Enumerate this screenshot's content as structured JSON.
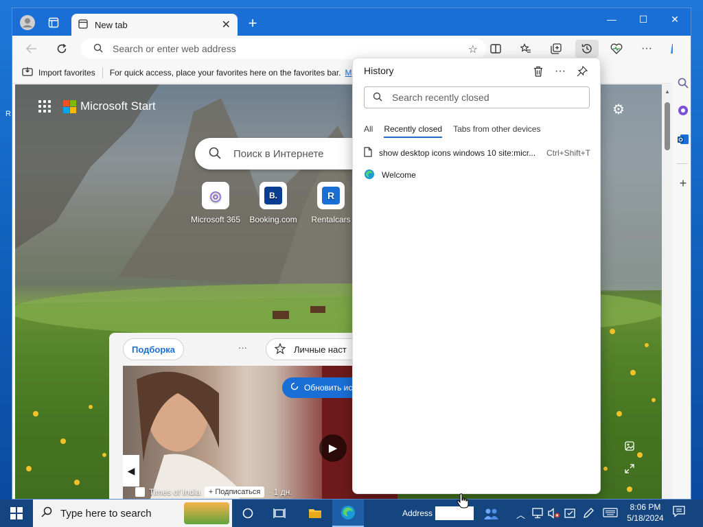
{
  "desktop": {
    "edge_letter": "R"
  },
  "browser": {
    "tab": {
      "title": "New tab",
      "close": "✕"
    },
    "new_tab": "+",
    "window_controls": {
      "minimize": "—",
      "maximize": "☐",
      "close": "✕"
    },
    "address": {
      "placeholder": "Search or enter web address"
    },
    "favorites_bar": {
      "import_label": "Import favorites",
      "hint": "For quick access, place your favorites here on the favorites bar.",
      "link": "M"
    }
  },
  "page": {
    "brand": "Microsoft Start",
    "search_placeholder": "Поиск в Интернете",
    "quick_links": [
      {
        "label": "Microsoft 365",
        "glyph": "◎",
        "color": "#7b4fd6"
      },
      {
        "label": "Booking.com",
        "glyph": "B.",
        "color": "#0b3d91"
      },
      {
        "label": "Rentalcars",
        "glyph": "R",
        "color": "#1a6fd6"
      }
    ],
    "feed": {
      "tab_selected": "Подборка",
      "more": "···",
      "personalize": "Личные наст",
      "refresh": "Обновить ист",
      "source": "Times of India",
      "subscribe": "+ Подписаться",
      "age": "· 1 дн."
    }
  },
  "history": {
    "title": "History",
    "search_placeholder": "Search recently closed",
    "tabs": [
      "All",
      "Recently closed",
      "Tabs from other devices"
    ],
    "active_tab": "Recently closed",
    "items": [
      {
        "title": "show desktop icons windows 10 site:micr...",
        "shortcut": "Ctrl+Shift+T",
        "icon": "page-icon"
      },
      {
        "title": "Welcome",
        "shortcut": "",
        "icon": "edge-icon"
      }
    ]
  },
  "taskbar": {
    "search_placeholder": "Type here to search",
    "address_label": "Address",
    "time": "8:06 PM",
    "date": "5/18/2024"
  },
  "colors": {
    "accent": "#1a6fd6",
    "titlebar": "#1a6fd6",
    "taskbar": "#14457f"
  }
}
